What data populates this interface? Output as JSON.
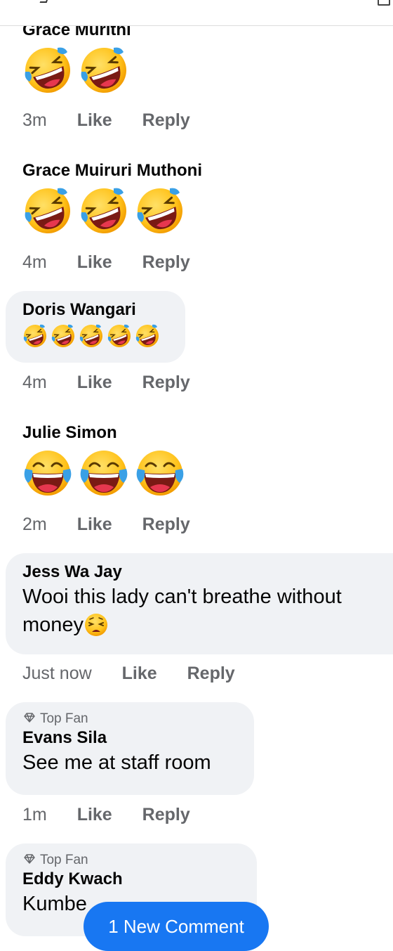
{
  "comments": [
    {
      "name": "Grace Murithi",
      "emoji_count": 2,
      "emoji": "rolling-on-floor-laughing",
      "time": "3m",
      "like": "Like",
      "reply": "Reply"
    },
    {
      "name": "Grace Muiruri Muthoni",
      "emoji_count": 3,
      "emoji": "rolling-on-floor-laughing",
      "time": "4m",
      "like": "Like",
      "reply": "Reply"
    },
    {
      "name": "Doris Wangari",
      "emoji_count": 5,
      "emoji": "rolling-on-floor-laughing",
      "time": "4m",
      "like": "Like",
      "reply": "Reply"
    },
    {
      "name": "Julie Simon",
      "emoji_count": 3,
      "emoji": "face-with-tears-of-joy",
      "time": "2m",
      "like": "Like",
      "reply": "Reply"
    },
    {
      "name": "Jess Wa Jay",
      "text_line1": "Wooi this lady can't breathe without",
      "text_line2": "money",
      "trailing_emoji": "weary-face",
      "time": "Just now",
      "like": "Like",
      "reply": "Reply"
    },
    {
      "badge": "Top Fan",
      "name": "Evans Sila",
      "text": "See me at staff room",
      "time": "1m",
      "like": "Like",
      "reply": "Reply"
    },
    {
      "badge": "Top Fan",
      "name": "Eddy Kwach",
      "text": "Kumbe"
    }
  ],
  "new_comment_pill": "1 New Comment",
  "colors": {
    "bubble": "#f0f2f5",
    "meta": "#65676b",
    "accent": "#1877f2"
  }
}
